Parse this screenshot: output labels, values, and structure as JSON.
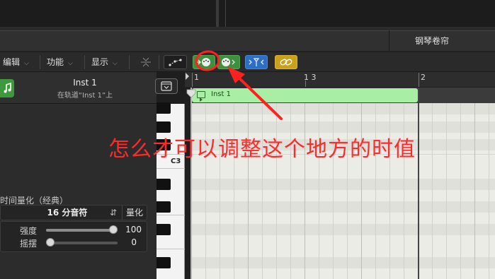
{
  "editor": {
    "title": "钢琴卷帘"
  },
  "toolbar": {
    "menus": [
      {
        "label": "编辑"
      },
      {
        "label": "功能"
      },
      {
        "label": "显示"
      }
    ],
    "tools": [
      "collapse-icon",
      "automation-icon",
      "midi-in-icon",
      "midi-out-icon",
      "scissors-icon",
      "link-icon"
    ]
  },
  "inspector": {
    "track_name": "Inst 1",
    "track_subtitle": "在轨道“Inst 1”上",
    "quantize": {
      "section_title": "时间量化（经典）",
      "value": "16 分音符",
      "button": "量化",
      "strength_label": "强度",
      "strength_value": "100",
      "strength_level": 1.0,
      "swing_label": "摇摆",
      "swing_value": "0",
      "swing_level": 0.0
    }
  },
  "piano": {
    "c3_label": "C3"
  },
  "ruler": {
    "marks": [
      "1",
      "1 3",
      "2"
    ]
  },
  "region": {
    "name": "Inst 1",
    "color": "#a9eea5"
  },
  "annotation": {
    "text": "怎么才可以调整这个地方的时值",
    "color": "#ff2a2a"
  }
}
